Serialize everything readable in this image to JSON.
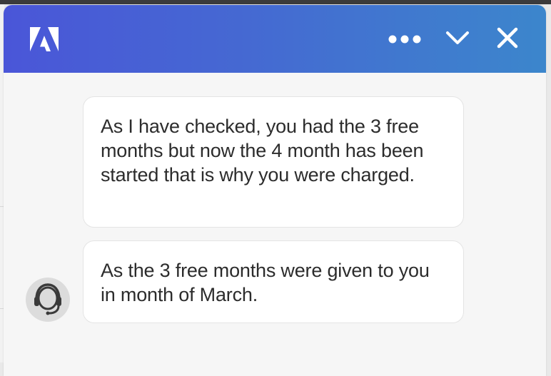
{
  "header": {
    "logo_icon": "adobe-logo",
    "more_icon": "more-horizontal-icon",
    "collapse_icon": "chevron-down-icon",
    "close_icon": "close-icon",
    "gradient_colors": [
      "#4a56d8",
      "#4569d2",
      "#3c86cc"
    ]
  },
  "messages": [
    {
      "sender": "agent",
      "text": "As I have checked, you had the 3 free months but now the 4 month has been started that is why you were charged."
    },
    {
      "sender": "agent",
      "text": "As the 3 free months were given to you in month of March."
    }
  ],
  "agent": {
    "avatar_icon": "headset-agent-icon"
  },
  "colors": {
    "panel_background": "#f6f6f6",
    "bubble_background": "#ffffff",
    "text": "#2c2c2c"
  }
}
